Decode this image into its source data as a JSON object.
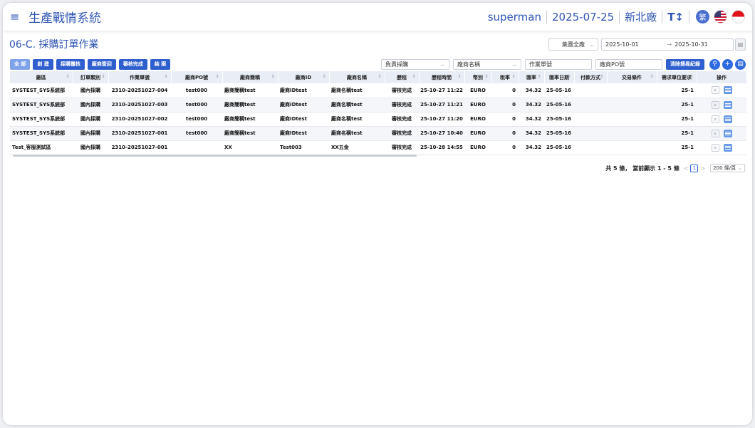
{
  "header": {
    "app_title": "生產戰情系統",
    "user": "superman",
    "date": "2025-07-25",
    "factory": "新北廠",
    "font_toggle": "T↕",
    "lang_badge": "繁"
  },
  "page": {
    "title": "06-C. 採購訂單作業",
    "company_select": "集團全廠",
    "date_from": "2025-10-01",
    "date_arrow": "→",
    "date_to": "2025-10-31"
  },
  "toolbar": {
    "all": "全 部",
    "create": "創 建",
    "review_purchase": "採購覆核",
    "vendor_return": "廠商簽回",
    "audit_done": "審核完成",
    "close": "結 案"
  },
  "filters": {
    "buyer_placeholder": "負責採購",
    "vendor_name_placeholder": "廠商名稱",
    "work_no_placeholder": "作業單號",
    "vendor_po_placeholder": "廠商PO號",
    "clear_label": "清除搜尋紀錄"
  },
  "table": {
    "columns": [
      "廠區",
      "訂單類別",
      "作業單號",
      "廠商PO號",
      "廠商簡稱",
      "廠商ID",
      "廠商名稱",
      "歷程",
      "歷程時間",
      "幣別",
      "稅率",
      "匯率",
      "匯率日期",
      "付款方式",
      "交易條件",
      "需求單位要求",
      "操作"
    ],
    "rows": [
      [
        "SYSTEST_SYS系統部",
        "國內採購",
        "2310-20251027-004",
        "test000",
        "廠商簡稱test",
        "廠商IDtest",
        "廠商名稱test",
        "審核完成",
        "25-10-27 11:22",
        "EURO",
        "0",
        "34.32",
        "25-05-16",
        "",
        "",
        "25-1"
      ],
      [
        "SYSTEST_SYS系統部",
        "國內採購",
        "2310-20251027-003",
        "test000",
        "廠商簡稱test",
        "廠商IDtest",
        "廠商名稱test",
        "審核完成",
        "25-10-27 11:21",
        "EURO",
        "0",
        "34.32",
        "25-05-16",
        "",
        "",
        "25-1"
      ],
      [
        "SYSTEST_SYS系統部",
        "國內採購",
        "2310-20251027-002",
        "test000",
        "廠商簡稱test",
        "廠商IDtest",
        "廠商名稱test",
        "審核完成",
        "25-10-27 11:20",
        "EURO",
        "0",
        "34.32",
        "25-05-16",
        "",
        "",
        "25-1"
      ],
      [
        "SYSTEST_SYS系統部",
        "國內採購",
        "2310-20251027-001",
        "test000",
        "廠商簡稱test",
        "廠商IDtest",
        "廠商名稱test",
        "審核完成",
        "25-10-27 10:40",
        "EURO",
        "0",
        "34.32",
        "25-05-16",
        "",
        "",
        "25-1"
      ],
      [
        "Test_客服測試區",
        "國內採購",
        "2310-20251027-001",
        "",
        "XX",
        "Test003",
        "XX五金",
        "審核完成",
        "25-10-28 14:55",
        "EURO",
        "0",
        "34.32",
        "25-05-16",
        "",
        "",
        "25-1"
      ]
    ]
  },
  "pager": {
    "summary": "共 5 條， 當前顯示 1 - 5 條",
    "prev": "<",
    "page": "1",
    "next": ">",
    "page_size": "200 條/頁"
  },
  "colors": {
    "primary": "#2f5fcf",
    "title_blue": "#2f56b4",
    "header_bg": "#e9edf5"
  }
}
